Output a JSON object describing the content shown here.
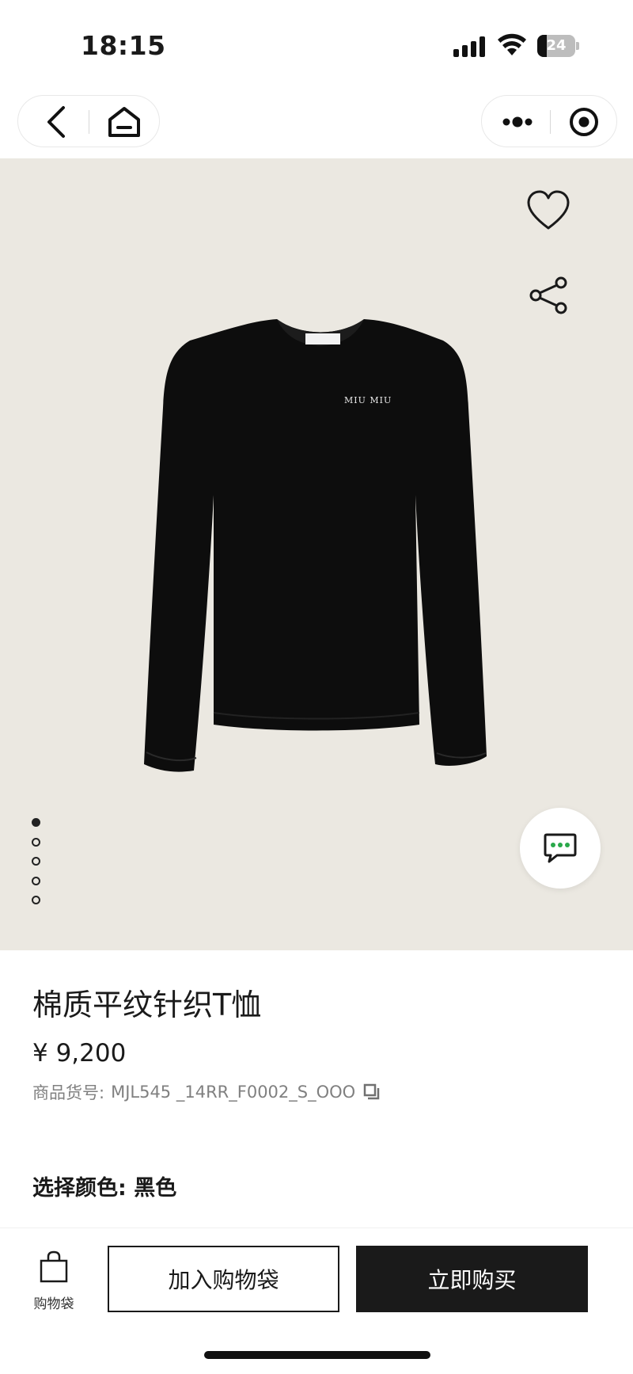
{
  "status_bar": {
    "time": "18:15",
    "battery_level": "24",
    "icons": [
      "signal-icon",
      "wifi-icon",
      "battery-icon"
    ]
  },
  "nav": {
    "left_icons": [
      "back-icon",
      "home-icon"
    ],
    "right_icons": [
      "more-icon",
      "target-icon"
    ]
  },
  "gallery": {
    "image_count": 5,
    "active_index": 0,
    "icons": [
      "heart-icon",
      "share-icon",
      "chat-icon"
    ],
    "background_color": "#ebe8e1",
    "shirt_color": "#0d0d0d",
    "brand_label": "MIU MIU"
  },
  "product": {
    "title": "棉质平纹针织T恤",
    "price": "¥ 9,200",
    "sku_label": "商品货号:",
    "sku_value": "MJL545 _14RR_F0002_S_OOO",
    "color_label": "选择颜色: 黑色"
  },
  "bottom_bar": {
    "bag_label": "购物袋",
    "add_to_cart_label": "加入购物袋",
    "buy_now_label": "立即购买"
  },
  "colors": {
    "primary_button": "#1a1a1a",
    "text_secondary": "#808080",
    "accent_green": "#2aa84a"
  }
}
